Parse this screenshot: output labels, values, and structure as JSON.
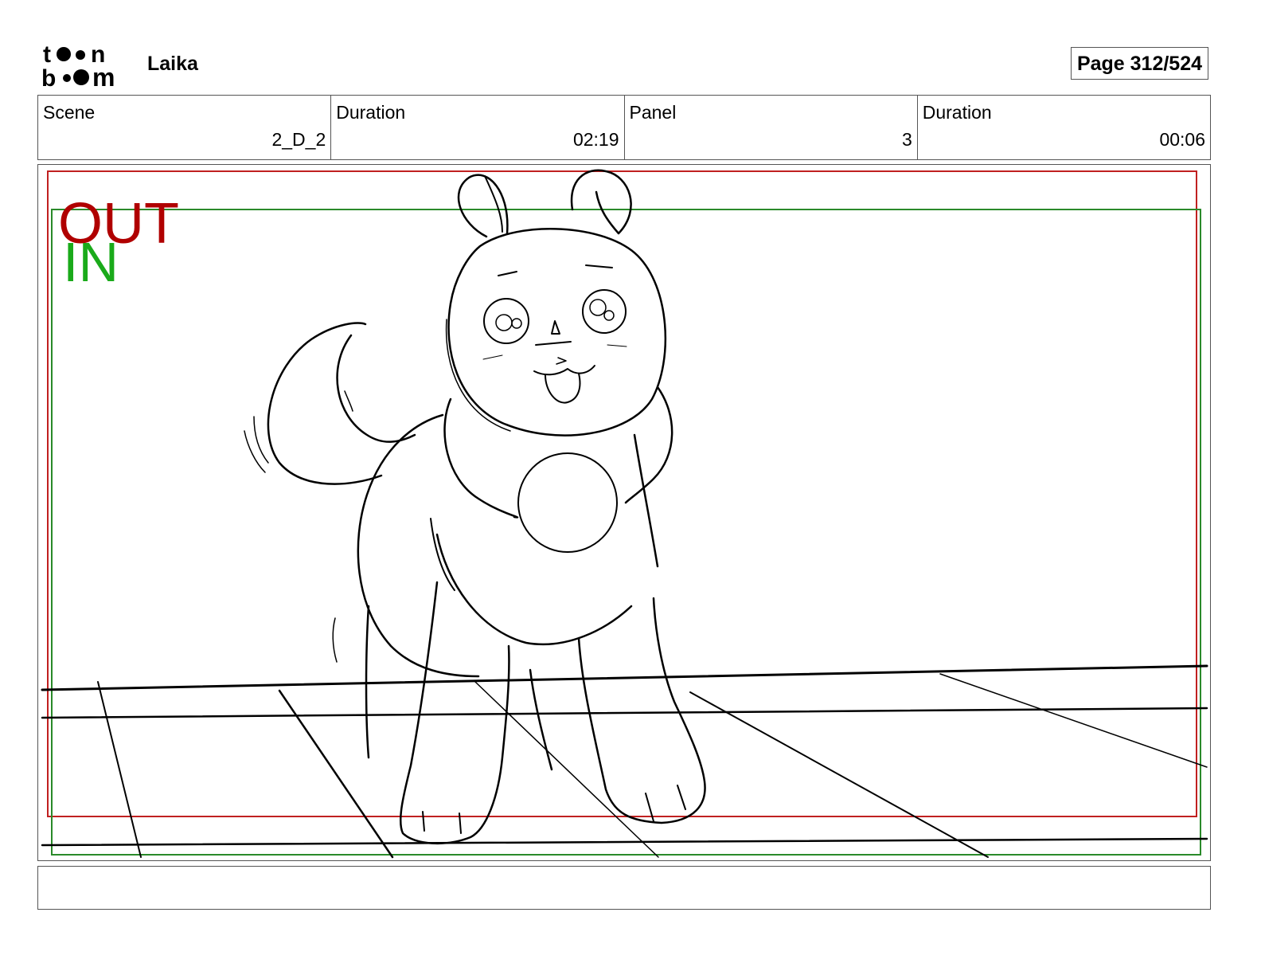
{
  "header": {
    "logo": {
      "line1": "toon",
      "line2": "boom"
    },
    "project": "Laika",
    "page_label": "Page 312/524"
  },
  "info": [
    {
      "label": "Scene",
      "value": "2_D_2"
    },
    {
      "label": "Duration",
      "value": "02:19"
    },
    {
      "label": "Panel",
      "value": "3"
    },
    {
      "label": "Duration",
      "value": "00:06"
    }
  ],
  "panel": {
    "out_label": "OUT",
    "in_label": "IN",
    "out_color": "#b00000",
    "in_color": "#1aaa1a"
  },
  "caption": ""
}
